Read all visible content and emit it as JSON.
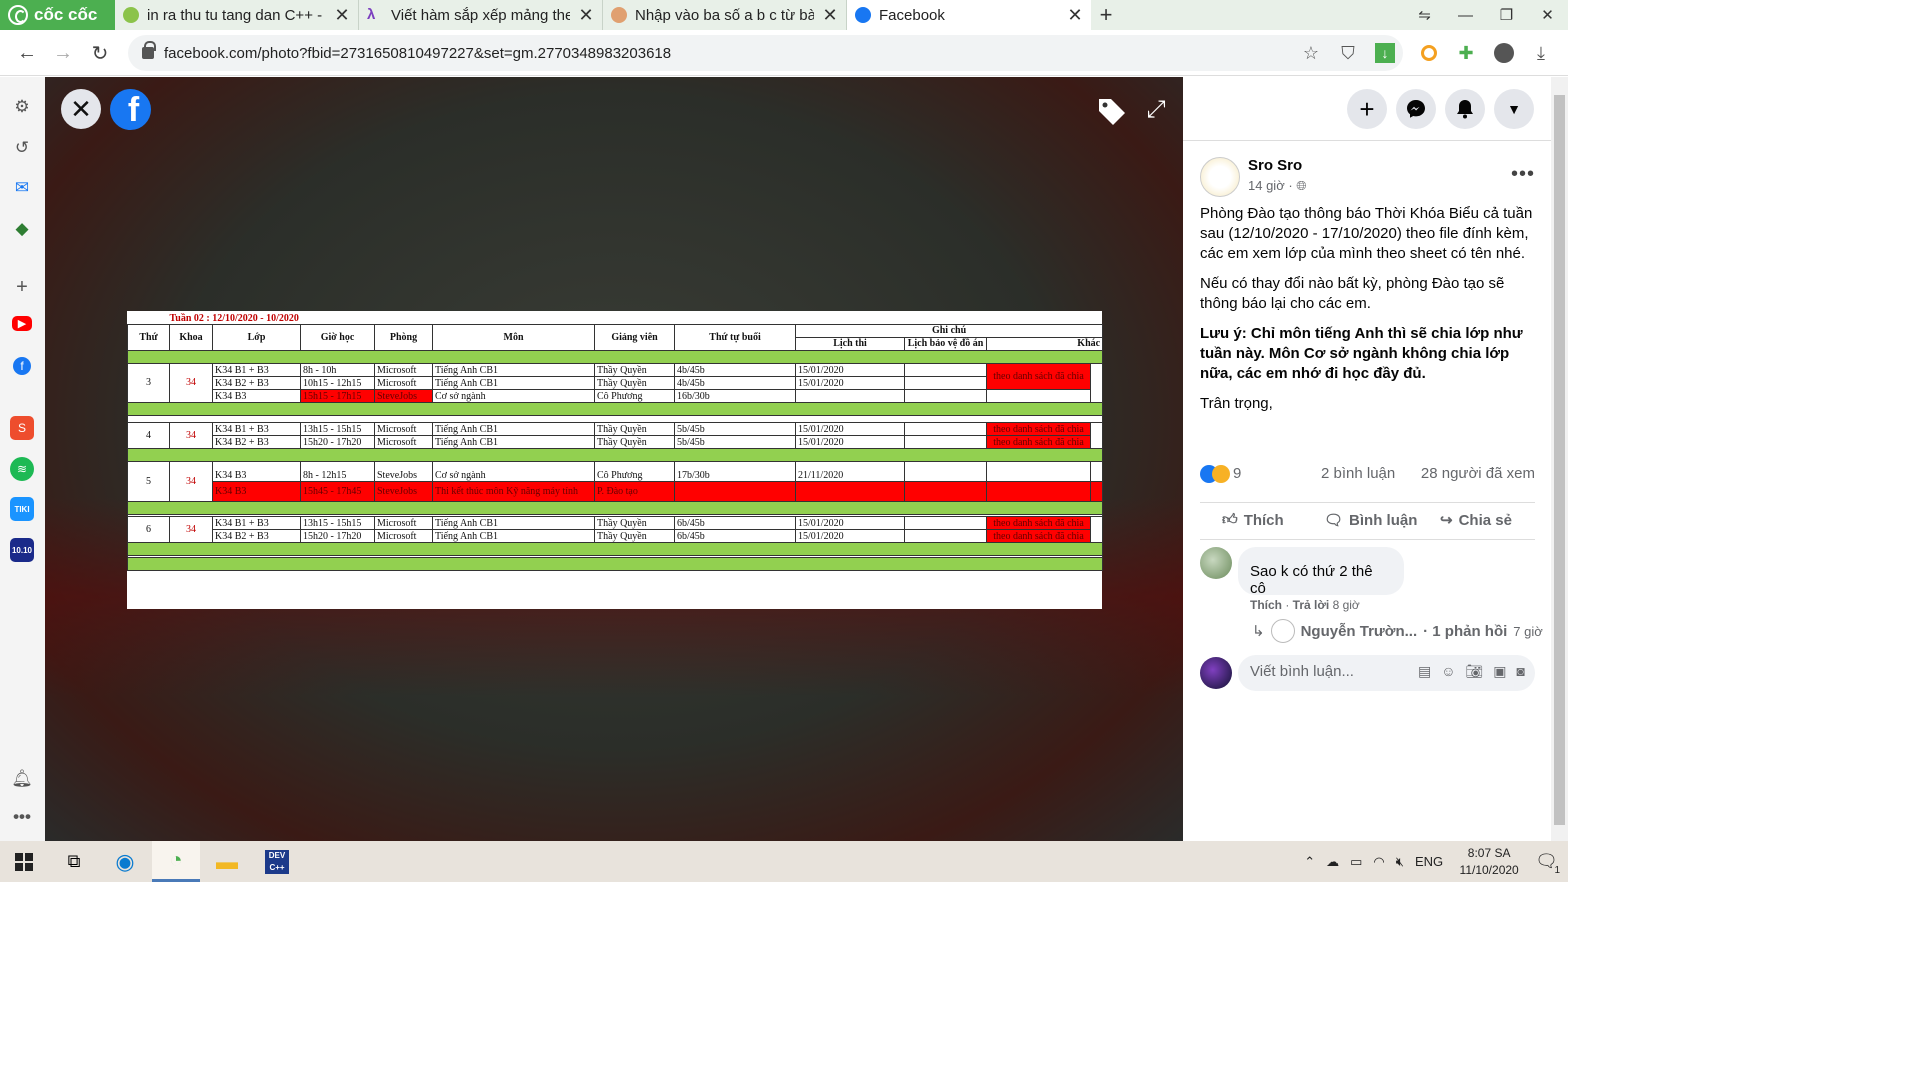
{
  "browser": {
    "brand": "cốc cốc",
    "tabs": [
      {
        "title": "in ra thu tu tang dan C++ - T",
        "active": false
      },
      {
        "title": "Viết hàm sắp xếp mảng theo",
        "active": false
      },
      {
        "title": "Nhập vào ba số a b c từ bàn p",
        "active": false
      },
      {
        "title": "Facebook",
        "active": true
      }
    ],
    "url": "facebook.com/photo?fbid=2731650810497227&set=gm.2770348983203618"
  },
  "sheet": {
    "title": "Tuần 02 : 12/10/2020 - 1",
    "title_tail": "0/2020",
    "headers": {
      "thu": "Thứ",
      "khoa": "Khoa",
      "lop": "Lớp",
      "gio": "Giờ học",
      "phong": "Phòng",
      "mon": "Môn",
      "gv": "Giảng viên",
      "buoi": "Thứ tự buổi",
      "ghichu": "Ghi chú",
      "lichthi": "Lịch thi",
      "baove": "Lịch bảo vệ đồ án",
      "khac": "Khác"
    },
    "groups": [
      {
        "thu": "3",
        "khoa": "34",
        "rows": [
          {
            "lop": "K34 B1 + B3",
            "gio": "8h - 10h",
            "phong": "Microsoft",
            "mon": "Tiếng Anh CB1",
            "gv": "Thầy Quyền",
            "buoi": "4b/45b",
            "thi": "15/01/2020",
            "khac": "theo danh sách đã chia"
          },
          {
            "lop": "K34 B2 + B3",
            "gio": "10h15 - 12h15",
            "phong": "Microsoft",
            "mon": "Tiếng Anh CB1",
            "gv": "Thầy Quyền",
            "buoi": "4b/45b",
            "thi": "15/01/2020",
            "khac": ""
          },
          {
            "lop": "K34 B3",
            "gio": "15h15 - 17h15",
            "phong": "SteveJobs",
            "mon": "Cơ sở ngành",
            "gv": "Cô Phương",
            "buoi": "16b/30b",
            "thi": "",
            "khac": ""
          }
        ]
      },
      {
        "thu": "4",
        "khoa": "34",
        "rows": [
          {
            "lop": "K34 B1 + B3",
            "gio": "13h15 - 15h15",
            "phong": "Microsoft",
            "mon": "Tiếng Anh CB1",
            "gv": "Thầy Quyền",
            "buoi": "5b/45b",
            "thi": "15/01/2020",
            "khac": "theo danh sách đã chia"
          },
          {
            "lop": "K34 B2 + B3",
            "gio": "15h20 - 17h20",
            "phong": "Microsoft",
            "mon": "Tiếng Anh CB1",
            "gv": "Thầy Quyền",
            "buoi": "5b/45b",
            "thi": "15/01/2020",
            "khac": "theo danh sách đã chia"
          }
        ]
      },
      {
        "thu": "5",
        "khoa": "34",
        "rows": [
          {
            "lop": "K34 B3",
            "gio": "8h - 12h15",
            "phong": "SteveJobs",
            "mon": "Cơ sở ngành",
            "gv": "Cô Phương",
            "buoi": "17b/30b",
            "thi": "21/11/2020",
            "khac": ""
          },
          {
            "lop": "K34 B3",
            "gio": "15h45 - 17h45",
            "phong": "SteveJobs",
            "mon": "Thi kết thúc môn Kỹ năng máy tính",
            "gv": "P. Đào tạo",
            "buoi": "",
            "thi": "",
            "khac": ""
          }
        ]
      },
      {
        "thu": "6",
        "khoa": "34",
        "rows": [
          {
            "lop": "K34 B1 + B3",
            "gio": "13h15 - 15h15",
            "phong": "Microsoft",
            "mon": "Tiếng Anh CB1",
            "gv": "Thầy Quyền",
            "buoi": "6b/45b",
            "thi": "15/01/2020",
            "khac": "theo danh sách đã chia"
          },
          {
            "lop": "K34 B2 + B3",
            "gio": "15h20 - 17h20",
            "phong": "Microsoft",
            "mon": "Tiếng Anh CB1",
            "gv": "Thầy Quyền",
            "buoi": "6b/45b",
            "thi": "15/01/2020",
            "khac": "theo danh sách đã chia"
          }
        ]
      }
    ]
  },
  "post": {
    "author": "Sro Sro",
    "time": "14 giờ ·",
    "p1": "Phòng Đào tạo thông báo Thời Khóa Biểu cả tuần sau (12/10/2020 - 17/10/2020) theo file đính kèm, các em xem lớp của mình theo sheet có tên nhé.",
    "p2": "Nếu có thay đổi nào bất kỳ, phòng Đào tạo sẽ thông báo lại cho các em.",
    "p3": "Lưu ý: Chỉ môn tiếng Anh thì sẽ chia lớp như tuần này. Môn Cơ sở ngành không chia lớp nữa, các em nhớ đi học đầy đủ.",
    "p4": "Trân trọng,",
    "reactions": "9",
    "comments": "2 bình luận",
    "views": "28 người đã xem",
    "like": "Thích",
    "comment": "Bình luận",
    "share": "Chia sẻ"
  },
  "comment1": {
    "text": "Sao k có thứ 2 thê cô",
    "like": "Thích",
    "reply": "Trả lời",
    "time": "8 giờ",
    "reply_name": "Nguyễn Trườn...",
    "reply_count": "· 1 phản hồi",
    "reply_time": "7 giờ"
  },
  "comment_input": {
    "placeholder": "Viết bình luận..."
  },
  "taskbar": {
    "lang": "ENG",
    "time": "8:07 SA",
    "date": "11/10/2020",
    "notif": "1"
  }
}
